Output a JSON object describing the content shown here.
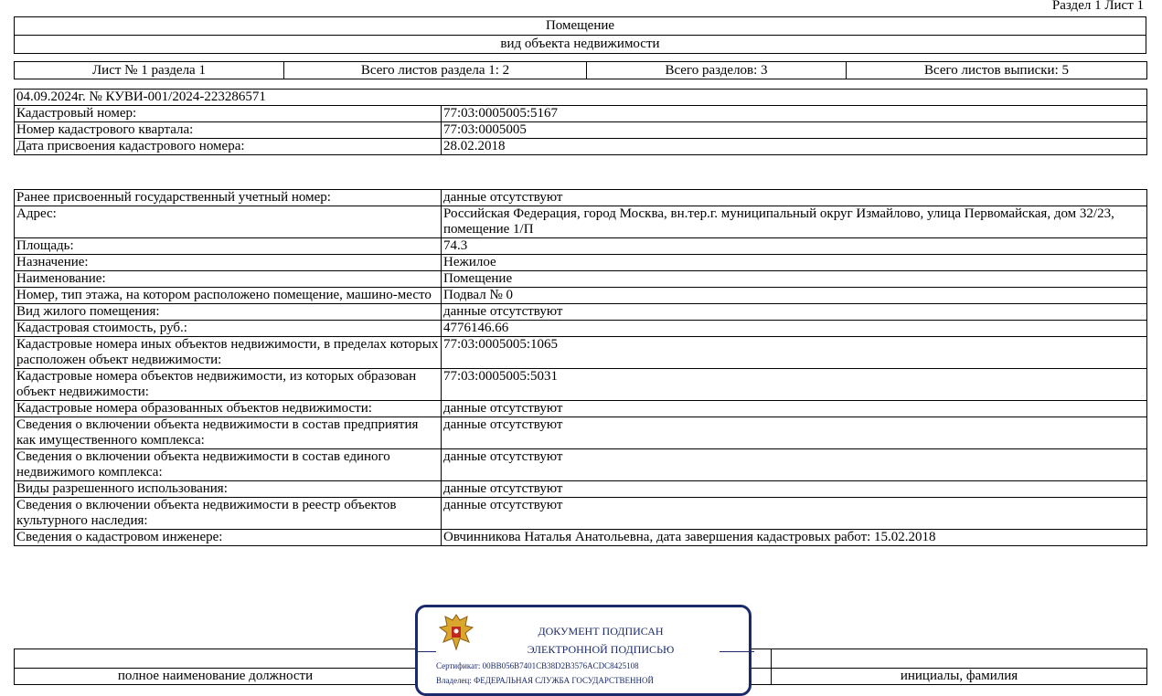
{
  "header": {
    "top_right": "Раздел 1 Лист 1"
  },
  "object": {
    "title": "Помещение",
    "subtitle": "вид объекта недвижимости"
  },
  "sheet_info": [
    "Лист № 1 раздела 1",
    "Всего листов раздела 1: 2",
    "Всего разделов: 3",
    "Всего листов выписки: 5"
  ],
  "doc_ref": "04.09.2024г. № КУВИ-001/2024-223286571",
  "block1": [
    {
      "label": "Кадастровый номер:",
      "value": "77:03:0005005:5167"
    },
    {
      "label": "Номер кадастрового квартала:",
      "value": "77:03:0005005"
    },
    {
      "label": "Дата присвоения кадастрового номера:",
      "value": "28.02.2018"
    }
  ],
  "block2": [
    {
      "label": "Ранее присвоенный государственный учетный номер:",
      "value": "данные отсутствуют"
    },
    {
      "label": "Адрес:",
      "value": "Российская Федерация, город Москва, вн.тер.г. муниципальный округ Измайлово, улица Первомайская, дом 32/23, помещение 1/П"
    },
    {
      "label": "Площадь:",
      "value": "74.3"
    },
    {
      "label": "Назначение:",
      "value": "Нежилое"
    },
    {
      "label": "Наименование:",
      "value": "Помещение"
    },
    {
      "label": "Номер, тип этажа, на котором расположено помещение, машино-место",
      "value": "Подвал № 0"
    },
    {
      "label": "Вид жилого помещения:",
      "value": "данные отсутствуют"
    },
    {
      "label": "Кадастровая стоимость, руб.:",
      "value": "4776146.66"
    },
    {
      "label": "Кадастровые номера иных объектов недвижимости, в пределах которых расположен объект недвижимости:",
      "value": "77:03:0005005:1065"
    },
    {
      "label": "Кадастровые номера объектов недвижимости, из которых образован объект недвижимости:",
      "value": "77:03:0005005:5031"
    },
    {
      "label": "Кадастровые номера образованных объектов недвижимости:",
      "value": "данные отсутствуют"
    },
    {
      "label": "Сведения о включении объекта недвижимости в состав предприятия как имущественного комплекса:",
      "value": "данные отсутствуют"
    },
    {
      "label": "Сведения о включении объекта недвижимости в состав единого недвижимого комплекса:",
      "value": "данные отсутствуют"
    },
    {
      "label": "Виды разрешенного использования:",
      "value": "данные отсутствуют"
    },
    {
      "label": "Сведения о включении объекта недвижимости в реестр объектов культурного наследия:",
      "value": "данные отсутствуют"
    },
    {
      "label": "Сведения о кадастровом инженере:",
      "value": "Овчинникова Наталья Анатольевна, дата завершения кадастровых работ: 15.02.2018"
    }
  ],
  "signature": {
    "line1": "ДОКУМЕНТ ПОДПИСАН",
    "line2": "ЭЛЕКТРОННОЙ ПОДПИСЬЮ",
    "cert": "Сертификат: 00BB056B7401CB38D2B3576ACDC8425108",
    "owner": "Владелец: ФЕДЕРАЛЬНАЯ СЛУЖБА ГОСУДАРСТВЕННОЙ"
  },
  "footer": {
    "col1": "полное наименование должности",
    "col3": "инициалы, фамилия"
  }
}
